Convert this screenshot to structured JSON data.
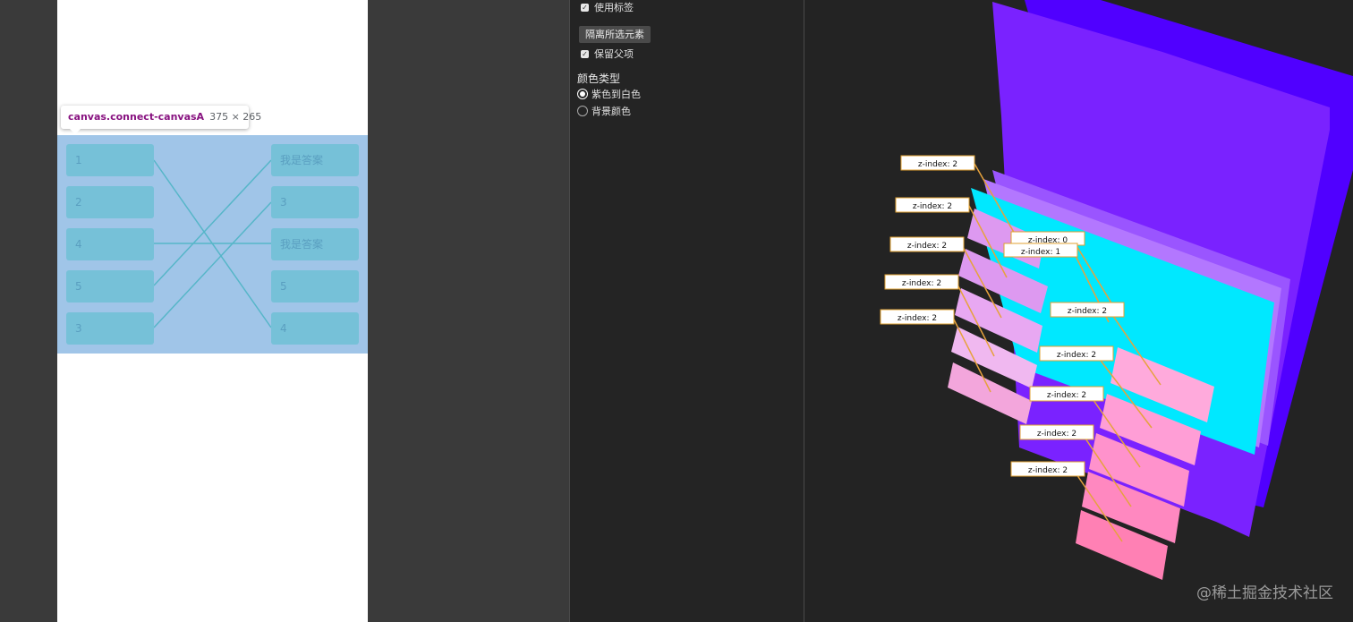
{
  "tooltip": {
    "name": "canvas.connect-canvasA",
    "size": "375 × 265"
  },
  "canvas": {
    "left_items": [
      "1",
      "2",
      "4",
      "5",
      "3"
    ],
    "right_items": [
      "我是答案",
      "3",
      "我是答案",
      "5",
      "4"
    ]
  },
  "panel": {
    "use_labels": "使用标签",
    "isolate_button": "隔离所选元素",
    "keep_parents": "保留父项",
    "color_type_title": "颜色类型",
    "color_options": [
      "紫色到白色",
      "背景颜色"
    ]
  },
  "view3d": {
    "labels": [
      "z-index: 2",
      "z-index: 2",
      "z-index: 2",
      "z-index: 2",
      "z-index: 2",
      "z-index: 0",
      "z-index: 1",
      "z-index: 2",
      "z-index: 2",
      "z-index: 2",
      "z-index: 2",
      "z-index: 2"
    ]
  },
  "watermark": "@稀土掘金技术社区",
  "colors": {
    "purple": "#7f22ff",
    "cyan": "#00e8ff",
    "label_border": "#e0a030"
  }
}
